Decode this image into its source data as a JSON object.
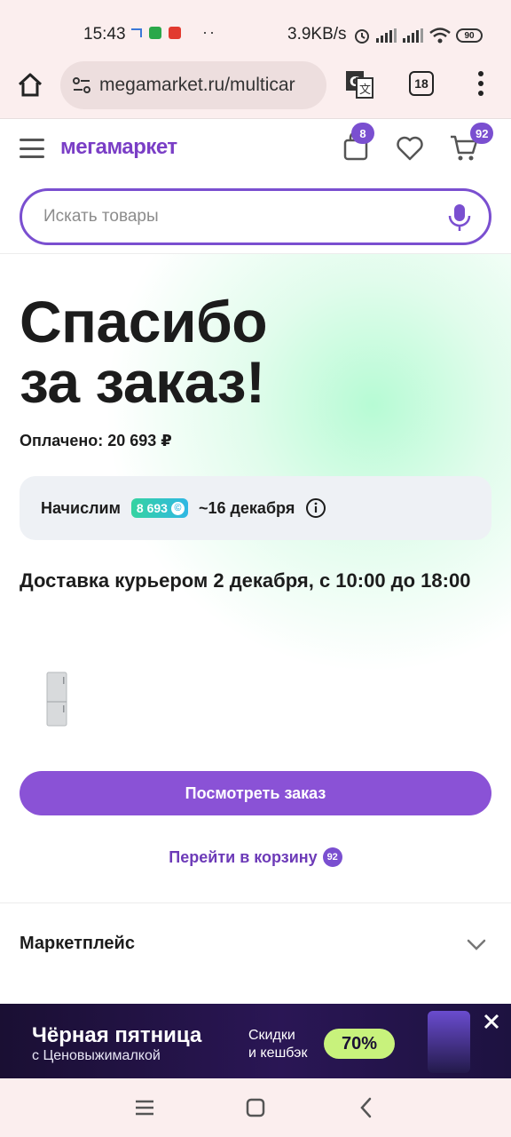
{
  "status_bar": {
    "time": "15:43",
    "net_speed": "3.9KB/s",
    "battery": "90"
  },
  "browser": {
    "url": "megamarket.ru/multicar",
    "tab_count": "18"
  },
  "header": {
    "logo": "мегамаркет",
    "orders_badge": "8",
    "cart_badge": "92",
    "search_placeholder": "Искать товары"
  },
  "main": {
    "title_line1": "Спасибо",
    "title_line2": "за заказ!",
    "paid": "Оплачено: 20 693 ₽",
    "bonus_label": "Начислим",
    "bonus_amount": "8 693",
    "bonus_date": "~16 декабря",
    "delivery": "Доставка курьером 2 декабря, с 10:00 до 18:00",
    "view_order_button": "Посмотреть заказ",
    "go_to_cart": "Перейти в корзину",
    "go_to_cart_badge": "92"
  },
  "marketplace": {
    "label": "Маркетплейс"
  },
  "banner": {
    "title": "Чёрная пятница",
    "subtitle": "с Ценовыжималкой",
    "discount_line1": "Скидки",
    "discount_line2": "и кешбэк",
    "percent": "70%"
  },
  "colors": {
    "brand": "#7a4fd0",
    "button": "#8a52d6",
    "link": "#6d3bb8",
    "bonus_chip_from": "#35d3a0",
    "bonus_chip_to": "#2fb7e4",
    "banner_pill": "#c8f27c"
  }
}
